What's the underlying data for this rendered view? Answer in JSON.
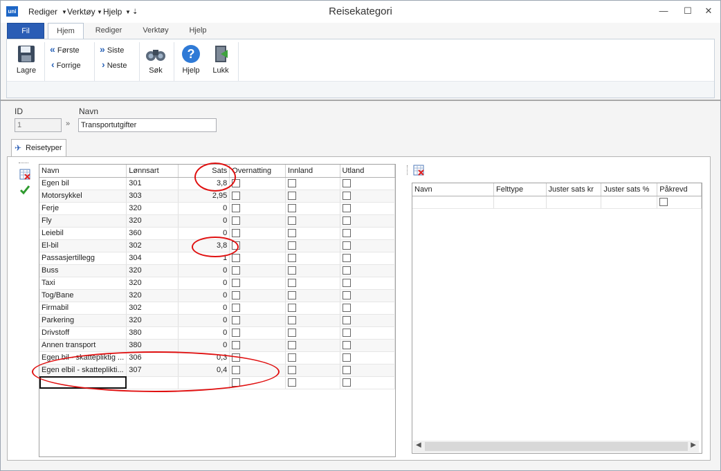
{
  "window": {
    "title": "Reisekategori",
    "logo": "uni"
  },
  "quick_menu": [
    "Rediger",
    "Verktøy",
    "Hjelp"
  ],
  "window_controls": {
    "minimize": "—",
    "maximize": "☐",
    "close": "✕"
  },
  "tabs": [
    "Fil",
    "Hjem",
    "Rediger",
    "Verktøy",
    "Hjelp"
  ],
  "ribbon": {
    "save": "Lagre",
    "first": "Første",
    "prev": "Forrige",
    "last": "Siste",
    "next": "Neste",
    "search": "Søk",
    "help": "Hjelp",
    "close": "Lukk"
  },
  "form": {
    "id_label": "ID",
    "id_value": "1",
    "name_label": "Navn",
    "name_value": "Transportutgifter"
  },
  "subtab": "Reisetyper",
  "left_grid": {
    "columns": [
      "Navn",
      "Lønnsart",
      "Sats",
      "Overnatting",
      "Innland",
      "Utland"
    ],
    "rows": [
      {
        "navn": "Egen bil",
        "lonnsart": "301",
        "sats": "3,8"
      },
      {
        "navn": "Motorsykkel",
        "lonnsart": "303",
        "sats": "2,95"
      },
      {
        "navn": "Ferje",
        "lonnsart": "320",
        "sats": "0"
      },
      {
        "navn": "Fly",
        "lonnsart": "320",
        "sats": "0"
      },
      {
        "navn": "Leiebil",
        "lonnsart": "360",
        "sats": "0"
      },
      {
        "navn": "El-bil",
        "lonnsart": "302",
        "sats": "3,8"
      },
      {
        "navn": "Passasjertillegg",
        "lonnsart": "304",
        "sats": "1"
      },
      {
        "navn": "Buss",
        "lonnsart": "320",
        "sats": "0"
      },
      {
        "navn": "Taxi",
        "lonnsart": "320",
        "sats": "0"
      },
      {
        "navn": "Tog/Bane",
        "lonnsart": "320",
        "sats": "0"
      },
      {
        "navn": "Firmabil",
        "lonnsart": "302",
        "sats": "0"
      },
      {
        "navn": "Parkering",
        "lonnsart": "320",
        "sats": "0"
      },
      {
        "navn": "Drivstoff",
        "lonnsart": "380",
        "sats": "0"
      },
      {
        "navn": "Annen transport",
        "lonnsart": "380",
        "sats": "0"
      },
      {
        "navn": "Egen bil - skattepliktig ...",
        "lonnsart": "306",
        "sats": "0,3"
      },
      {
        "navn": "Egen elbil - skatteplikti...",
        "lonnsart": "307",
        "sats": "0,4"
      }
    ]
  },
  "right_grid": {
    "columns": [
      "Navn",
      "Felttype",
      "Juster sats kr",
      "Juster sats %",
      "Påkrevd"
    ]
  },
  "colors": {
    "accent": "#2a5db5",
    "highlight": "#e01010"
  }
}
